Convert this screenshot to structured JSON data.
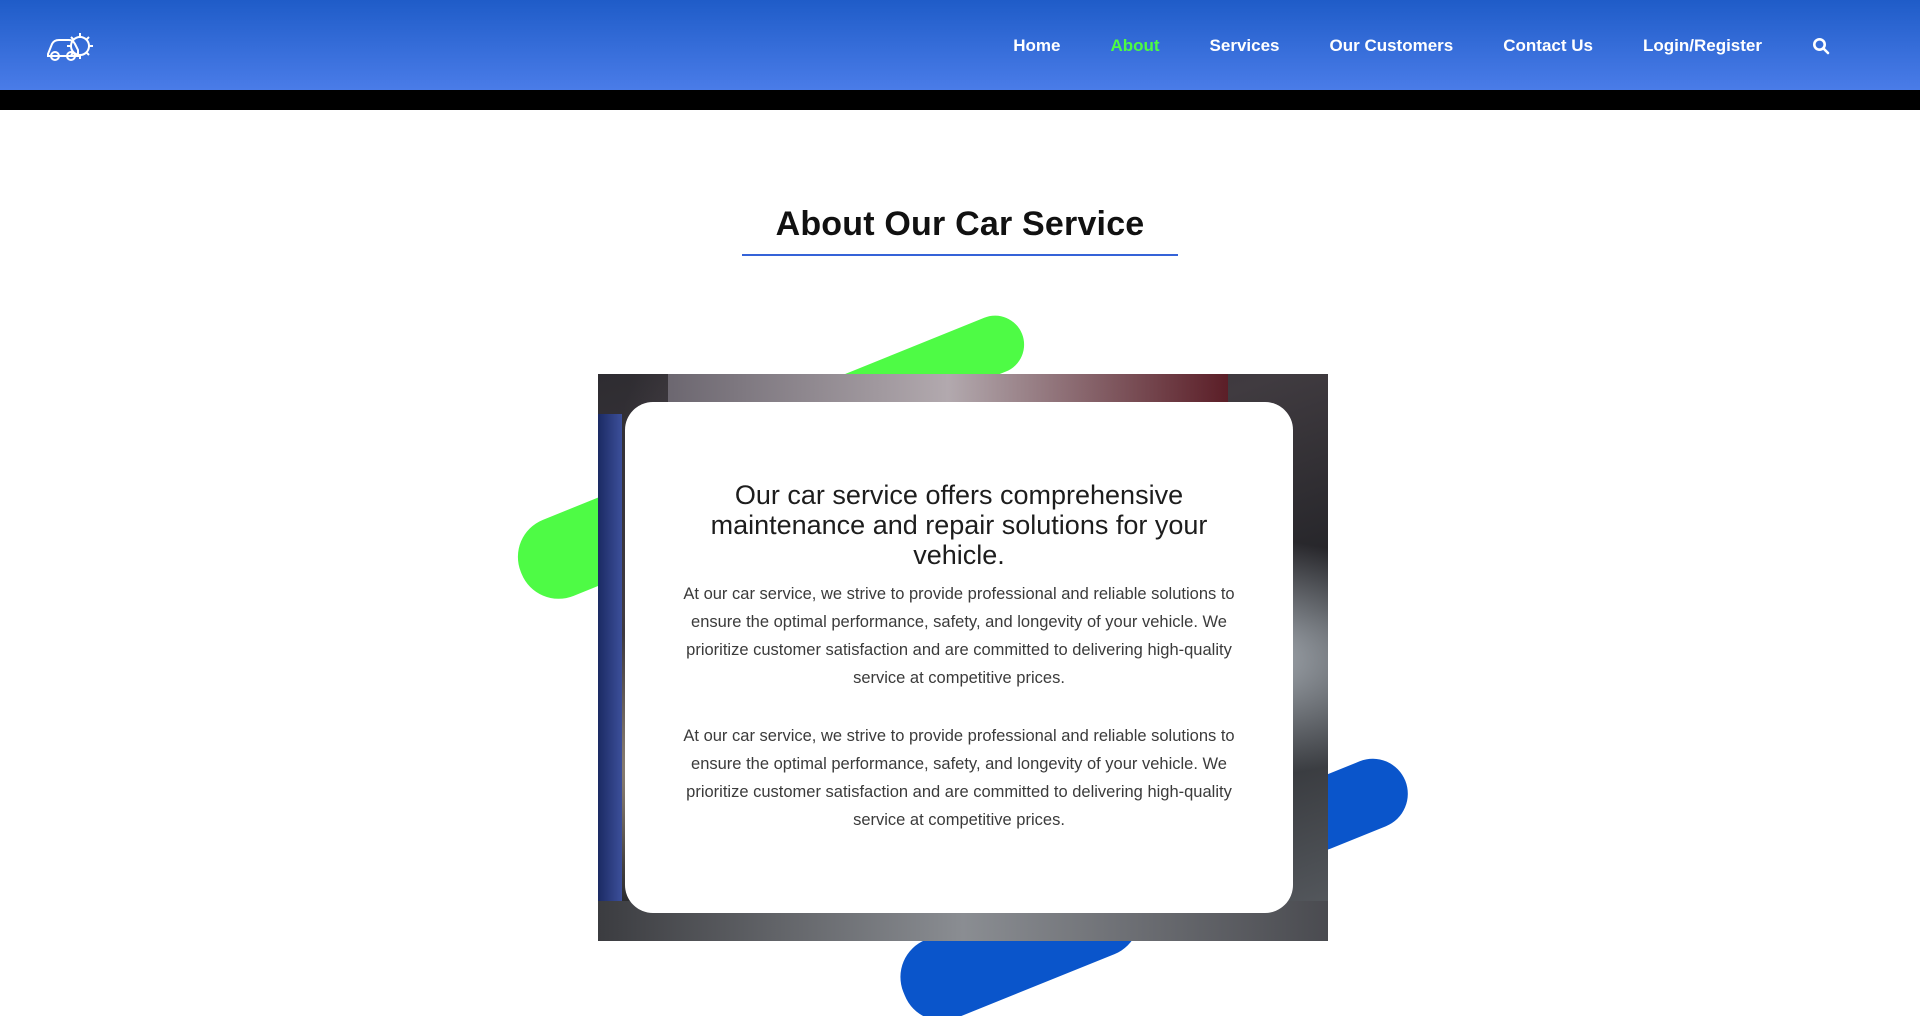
{
  "nav": {
    "logo": "car-gear-logo",
    "links": [
      {
        "label": "Home",
        "active": false
      },
      {
        "label": "About",
        "active": true
      },
      {
        "label": "Services",
        "active": false
      },
      {
        "label": "Our Customers",
        "active": false
      },
      {
        "label": "Contact Us",
        "active": false
      },
      {
        "label": "Login/Register",
        "active": false
      }
    ],
    "search_icon": "search-icon",
    "active_color": "#4dfc43"
  },
  "about": {
    "title": "About Our Car Service",
    "card_heading": "Our car service offers comprehensive maintenance and repair solutions for your vehicle.",
    "paragraphs": [
      "At our car service, we strive to provide professional and reliable solutions to ensure the optimal performance, safety, and longevity of your vehicle. We prioritize customer satisfaction and are committed to delivering high-quality service at competitive prices.",
      "At our car service, we strive to provide professional and reliable solutions to ensure the optimal performance, safety, and longevity of your vehicle. We prioritize customer satisfaction and are committed to delivering high-quality service at competitive prices."
    ]
  },
  "colors": {
    "nav_gradient_top": "#1f5cc8",
    "nav_gradient_bottom": "#4a7ce8",
    "accent_green": "#4efb45",
    "accent_blue": "#0a55cb",
    "title_rule": "#3563d8"
  }
}
